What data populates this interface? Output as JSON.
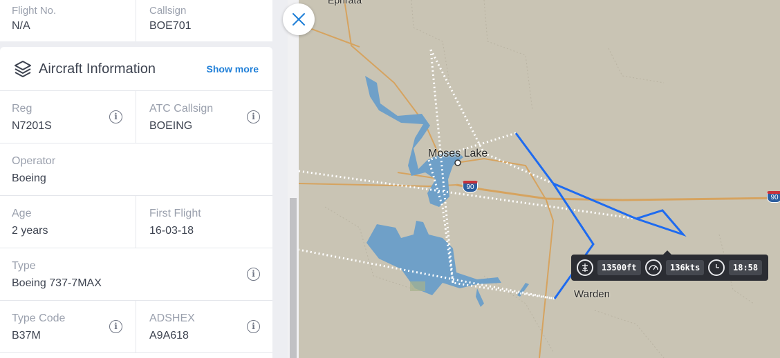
{
  "panel": {
    "top_fields": [
      {
        "label": "Flight No.",
        "value": "N/A"
      },
      {
        "label": "Callsign",
        "value": "BOE701"
      }
    ],
    "section": {
      "title": "Aircraft Information",
      "icon": "layers-icon",
      "show_more": "Show more"
    },
    "rows": [
      [
        {
          "label": "Reg",
          "value": "N7201S",
          "info": true
        },
        {
          "label": "ATC Callsign",
          "value": "BOEING",
          "info": true
        }
      ],
      [
        {
          "label": "Operator",
          "value": "Boeing",
          "info": false
        }
      ],
      [
        {
          "label": "Age",
          "value": "2 years",
          "info": false
        },
        {
          "label": "First Flight",
          "value": "16-03-18",
          "info": false
        }
      ],
      [
        {
          "label": "Type",
          "value": "Boeing 737-7MAX",
          "info": true
        }
      ],
      [
        {
          "label": "Type Code",
          "value": "B37M",
          "info": true
        },
        {
          "label": "ADSHEX",
          "value": "A9A618",
          "info": true
        }
      ]
    ]
  },
  "map": {
    "labels": {
      "ephrata": "Ephrata",
      "moses_lake": "Moses Lake",
      "warden": "Warden"
    },
    "interstate": [
      "90",
      "90"
    ],
    "colors": {
      "land": "#c9c4b4",
      "water": "#6fa0c8",
      "road": "#d6a35f",
      "track_live": "#1e6bf0",
      "track_past": "#ffffff"
    }
  },
  "flight_tooltip": {
    "altitude": "13500ft",
    "speed": "136kts",
    "time": "18:58",
    "icons": [
      "altitude-icon",
      "speedometer-icon",
      "clock-icon"
    ]
  }
}
